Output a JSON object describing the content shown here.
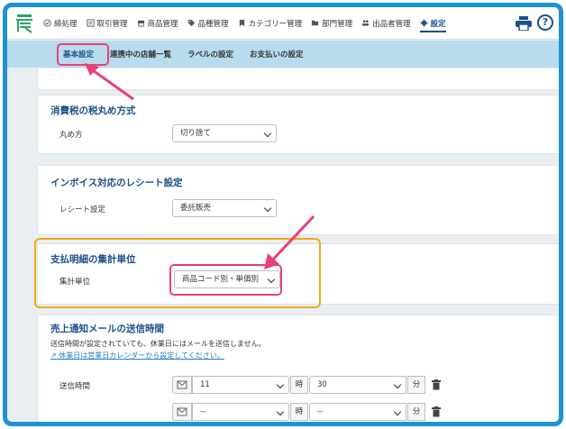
{
  "nav": {
    "items": [
      {
        "label": "締処理",
        "icon": "check-circle-icon"
      },
      {
        "label": "取引管理",
        "icon": "document-icon"
      },
      {
        "label": "商品管理",
        "icon": "shop-icon"
      },
      {
        "label": "品種管理",
        "icon": "tag-icon"
      },
      {
        "label": "カテゴリー管理",
        "icon": "bookmark-icon"
      },
      {
        "label": "部門管理",
        "icon": "folder-icon"
      },
      {
        "label": "出品者管理",
        "icon": "people-icon"
      },
      {
        "label": "設定",
        "icon": "gear-icon"
      }
    ],
    "help": "?"
  },
  "subnav": {
    "tabs": [
      "基本設定",
      "連携中の店舗一覧",
      "ラベルの設定",
      "お支払いの設定"
    ]
  },
  "sections": {
    "rounding": {
      "title": "消費税の税丸め方式",
      "label": "丸め方",
      "value": "切り捨て"
    },
    "invoice": {
      "title": "インボイス対応のレシート設定",
      "label": "レシート設定",
      "value": "委託販売"
    },
    "payment": {
      "title": "支払明細の集計単位",
      "label": "集計単位",
      "value": "商品コード別・単価別"
    },
    "mail": {
      "title": "売上通知メールの送信時間",
      "note": "送信時間が設定されていても、休業日にはメールを送信しません。",
      "link": "休業日は営業日カレンダーから設定してください。",
      "label": "送信時間",
      "row1": {
        "hour": "11",
        "minute": "30"
      },
      "row2": {
        "hour": "--",
        "minute": "--"
      },
      "hour_unit": "時",
      "minute_unit": "分"
    }
  },
  "colors": {
    "accent": "#1a4f8b",
    "frame": "#1d92d4",
    "subbar": "#b8dced",
    "highlight_pink": "#e8407a",
    "highlight_orange": "#f0a81c"
  }
}
